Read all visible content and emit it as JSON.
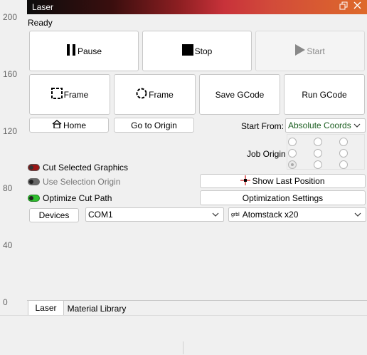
{
  "ruler": {
    "ticks": [
      "200",
      "160",
      "120",
      "80",
      "40",
      "0"
    ]
  },
  "window": {
    "title": "Laser",
    "restore_icon": "restore-icon",
    "close_icon": "close-icon"
  },
  "status": "Ready",
  "controls": {
    "pause": "Pause",
    "stop": "Stop",
    "start": "Start",
    "frame_rect": "Frame",
    "frame_circle": "Frame",
    "save_gcode": "Save GCode",
    "run_gcode": "Run GCode",
    "home": "Home",
    "go_to_origin": "Go to Origin",
    "start_from_label": "Start From:",
    "start_from_value": "Absolute Coords",
    "job_origin_label": "Job Origin",
    "job_origin_selected": "bottom-left",
    "cut_selected": "Cut Selected Graphics",
    "use_selection_origin": "Use Selection Origin",
    "optimize_cut_path": "Optimize Cut Path",
    "show_last_position": "Show Last Position",
    "optimization_settings": "Optimization Settings",
    "devices": "Devices",
    "port": "COM1",
    "device_prefix": "grbl",
    "device": "Atomstack x20"
  },
  "tabs": [
    "Laser",
    "Material Library"
  ],
  "colors": {
    "start_from_text": "#1b5e20",
    "toggle_on": "#2fbf2f",
    "toggle_red": "#9b1616"
  }
}
